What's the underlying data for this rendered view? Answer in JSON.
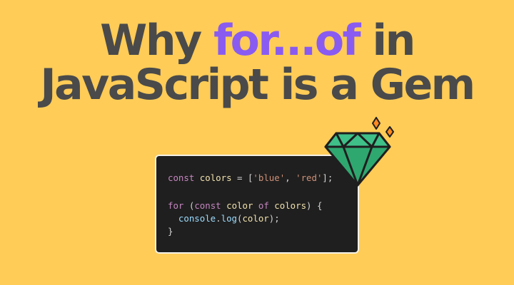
{
  "headline": {
    "line1_lead": "Why ",
    "line1_accent": "for...of",
    "line1_trail": " in",
    "line2": "JavaScript is a Gem"
  },
  "code": {
    "line1": {
      "kw": "const",
      "var": "colors",
      "eq": "=",
      "open": "[",
      "str1": "'blue'",
      "comma": ", ",
      "str2": "'red'",
      "close": "];"
    },
    "line3": {
      "kw_for": "for",
      "paren_open": "(",
      "kw_const": "const",
      "var_item": "color",
      "kw_of": "of",
      "var_list": "colors",
      "paren_close_brace": ") {"
    },
    "line4": {
      "obj": "console",
      "dot": ".",
      "method": "log",
      "open": "(",
      "arg": "color",
      "close": ");"
    },
    "line5": {
      "brace": "}"
    }
  },
  "colors": {
    "background": "#fecc57",
    "headline": "#4a4a4a",
    "accent": "#8a5bf0",
    "code_background": "#1f1f1f",
    "gem_green": "#2fa870",
    "sparkle_orange": "#ff8a1f"
  },
  "icons": {
    "gem": "gem-icon",
    "sparkles": "sparkle-icon"
  }
}
